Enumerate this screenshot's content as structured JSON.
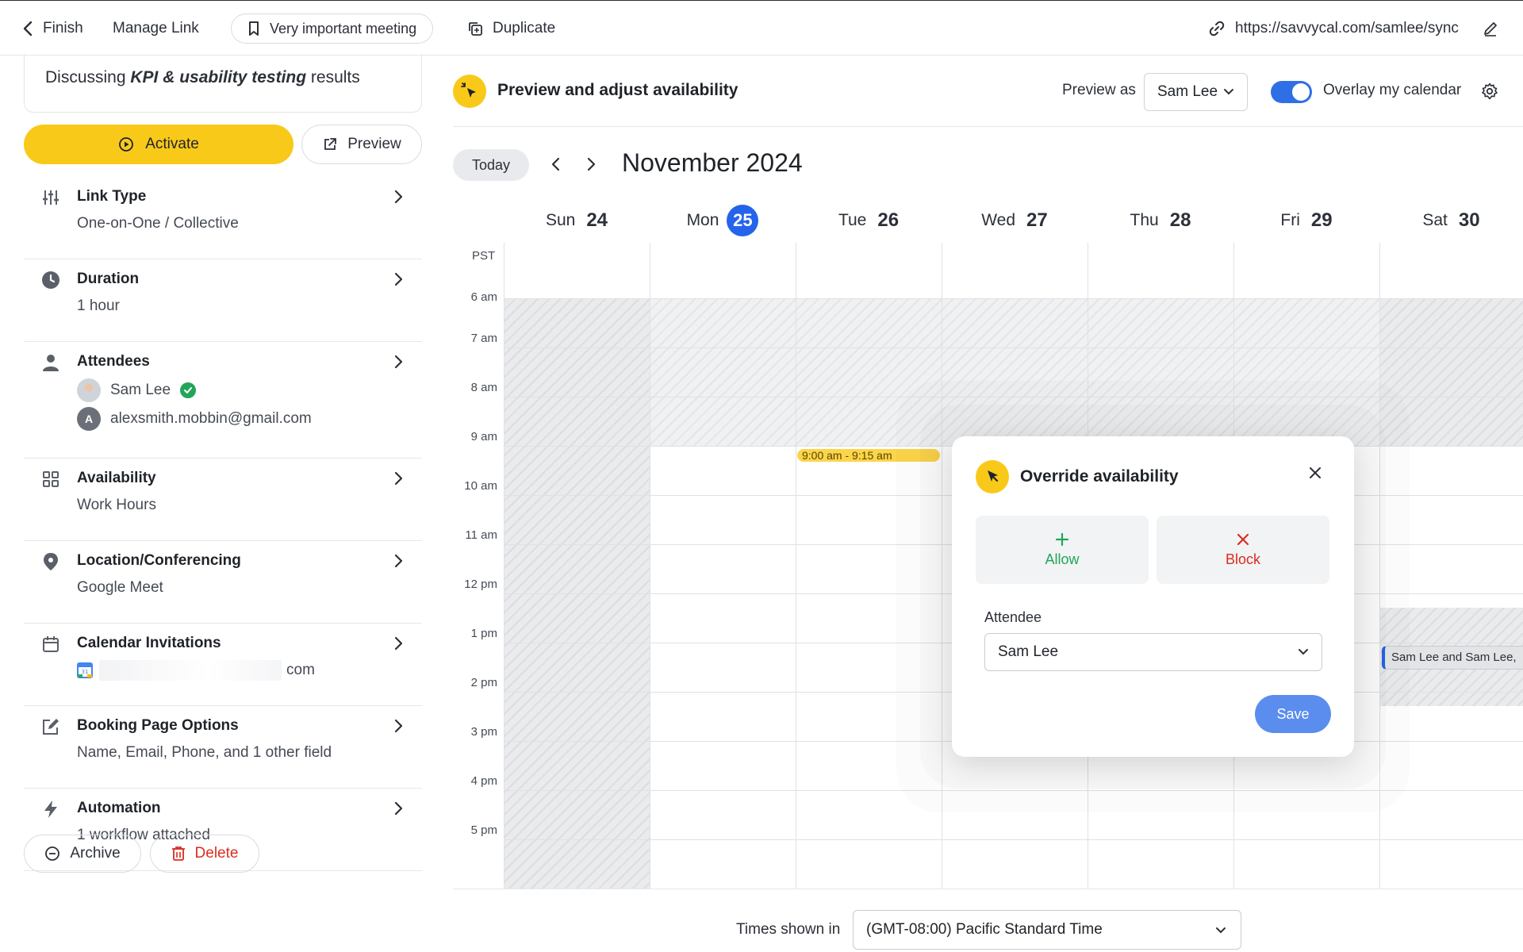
{
  "topbar": {
    "finish_label": "Finish",
    "manage_link_label": "Manage Link",
    "link_name": "Very important meeting",
    "duplicate_label": "Duplicate",
    "url": "https://savvycal.com/samlee/sync"
  },
  "left_panel": {
    "subtitle_prefix": "Discussing ",
    "subtitle_emphasis": "KPI & usability testing",
    "subtitle_suffix": " results",
    "activate_label": "Activate",
    "preview_label": "Preview",
    "settings": [
      {
        "title": "Link Type",
        "value": "One-on-One / Collective",
        "icon": "sliders-icon"
      },
      {
        "title": "Duration",
        "value": "1 hour",
        "icon": "clock-icon"
      },
      {
        "title": "Attendees",
        "icon": "person-icon",
        "attendees": [
          {
            "name": "Sam Lee",
            "verified": true,
            "avatar": "photo"
          },
          {
            "name": "alexsmith.mobbin@gmail.com",
            "avatar_letter": "A"
          }
        ]
      },
      {
        "title": "Availability",
        "value": "Work Hours",
        "icon": "grid-icon"
      },
      {
        "title": "Location/Conferencing",
        "value": "Google Meet",
        "icon": "location-pin-icon"
      },
      {
        "title": "Calendar Invitations",
        "value_suffix": "com",
        "icon": "calendar-icon"
      },
      {
        "title": "Booking Page Options",
        "value": "Name, Email, Phone, and 1 other field",
        "icon": "edit-icon"
      },
      {
        "title": "Automation",
        "value": "1 workflow attached",
        "icon": "lightning-icon"
      }
    ],
    "archive_label": "Archive",
    "delete_label": "Delete"
  },
  "preview": {
    "title": "Preview and adjust availability",
    "preview_as_label": "Preview as",
    "preview_as_value": "Sam Lee",
    "overlay_label": "Overlay my calendar",
    "overlay_enabled": true
  },
  "calendar": {
    "today_label": "Today",
    "month_title": "November 2024",
    "timezone_abbr": "PST",
    "days": [
      {
        "name": "Sun",
        "num": "24"
      },
      {
        "name": "Mon",
        "num": "25",
        "today": true
      },
      {
        "name": "Tue",
        "num": "26"
      },
      {
        "name": "Wed",
        "num": "27"
      },
      {
        "name": "Thu",
        "num": "28"
      },
      {
        "name": "Fri",
        "num": "29"
      },
      {
        "name": "Sat",
        "num": "30"
      }
    ],
    "hours": [
      "6 am",
      "7 am",
      "8 am",
      "9 am",
      "10 am",
      "11 am",
      "12 pm",
      "1 pm",
      "2 pm",
      "3 pm",
      "4 pm",
      "5 pm"
    ],
    "events": [
      {
        "day": "Tue",
        "label": "9:00 am - 9:15 am"
      },
      {
        "day": "Sat",
        "label": "Sam Lee and Sam Lee,"
      }
    ]
  },
  "override_popup": {
    "title": "Override availability",
    "allow_label": "Allow",
    "block_label": "Block",
    "attendee_label": "Attendee",
    "attendee_value": "Sam Lee",
    "save_label": "Save"
  },
  "footer": {
    "times_shown_label": "Times shown in",
    "timezone_value": "(GMT-08:00) Pacific Standard Time"
  },
  "colors": {
    "accent_yellow": "#f9c91a",
    "primary_blue": "#2563eb",
    "allow_green": "#22a559",
    "block_red": "#d92d20"
  }
}
